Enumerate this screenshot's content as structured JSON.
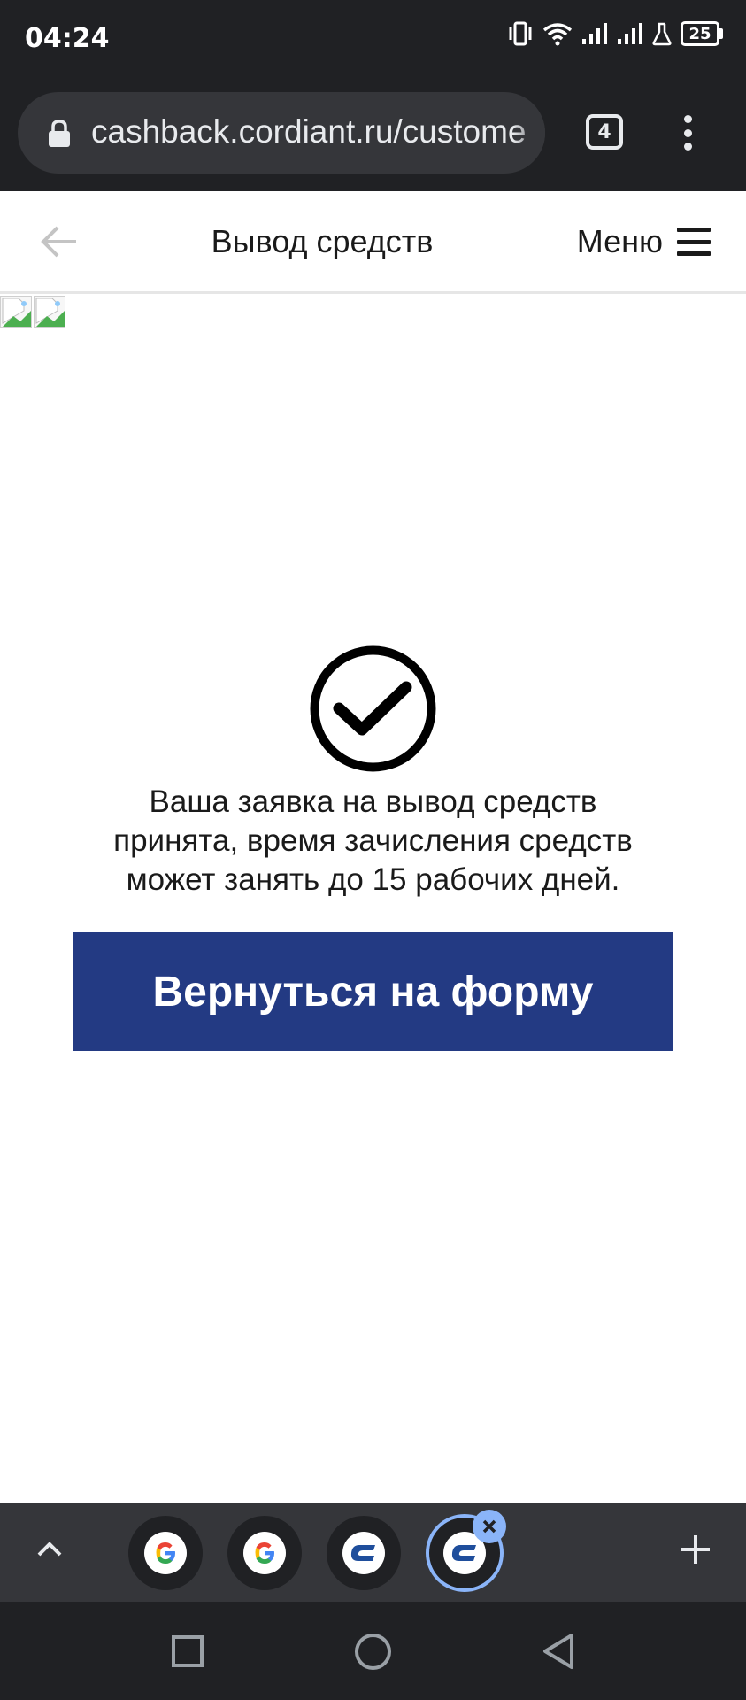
{
  "status_bar": {
    "time": "04:24",
    "battery": "25",
    "icons": [
      "vibrate-icon",
      "wifi-icon",
      "signal-icon",
      "signal-icon",
      "lab-icon",
      "battery-icon"
    ]
  },
  "browser": {
    "url": "cashback.cordiant.ru/custome",
    "tab_count": "4"
  },
  "header": {
    "title": "Вывод средств",
    "menu_label": "Меню"
  },
  "success": {
    "message_lines": [
      "Ваша заявка на вывод средств",
      "принята, время зачисления средств",
      "может занять до 15 рабочих дней."
    ],
    "button_label": "Вернуться на форму"
  },
  "tab_strip": {
    "tabs": [
      {
        "icon": "google-icon"
      },
      {
        "icon": "google-icon"
      },
      {
        "icon": "cordiant-icon"
      },
      {
        "icon": "cordiant-icon",
        "active": true
      }
    ]
  },
  "colors": {
    "button_bg": "#233a83",
    "chrome_dark": "#202124",
    "accent_blue": "#8ab4f8"
  }
}
